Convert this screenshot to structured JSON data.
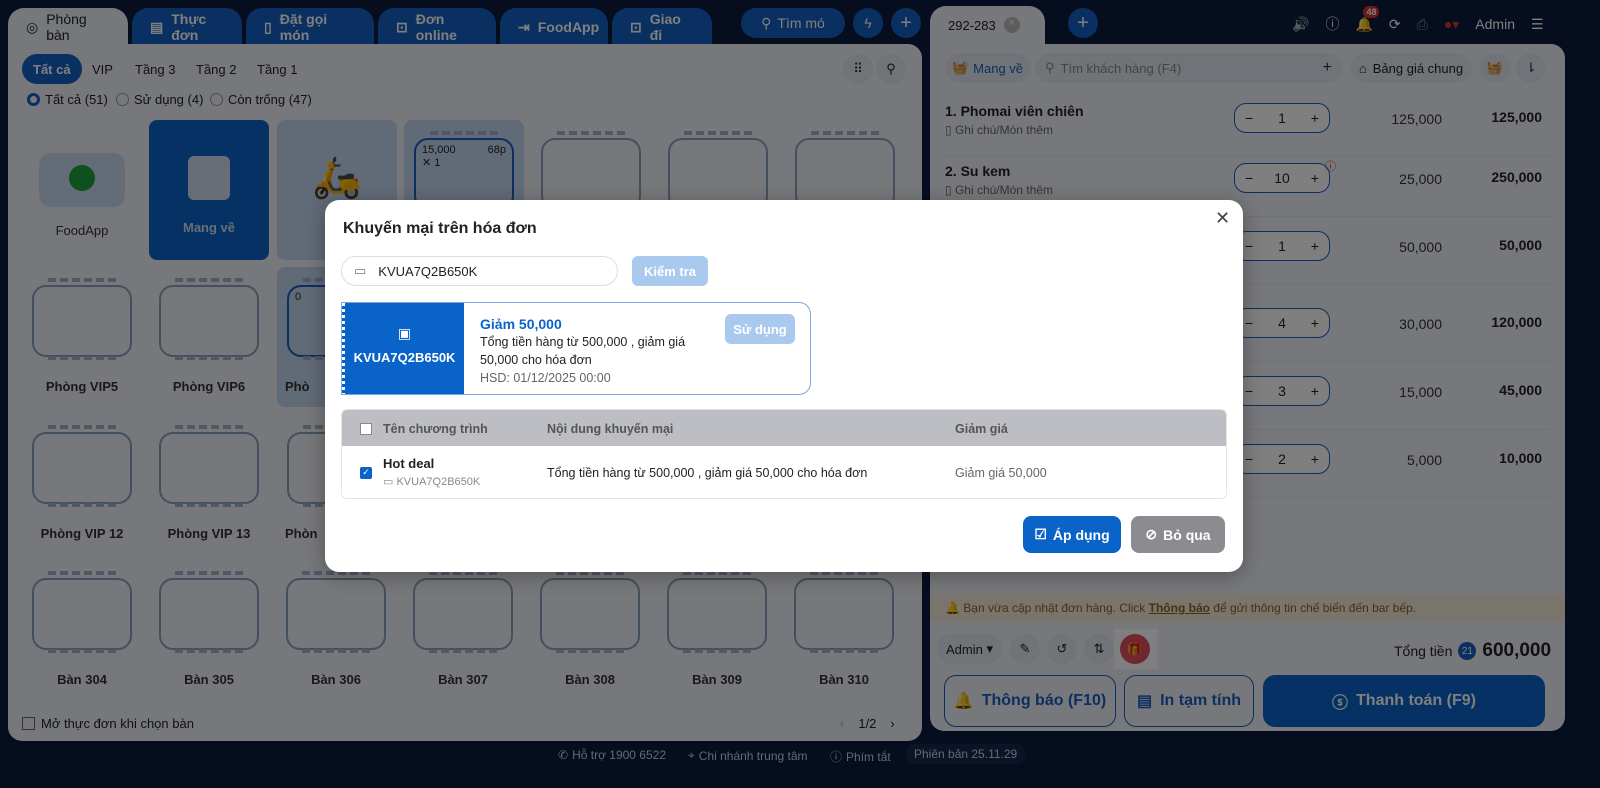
{
  "nav": {
    "tabs": [
      "Phòng bàn",
      "Thực đơn",
      "Đặt gọi món",
      "Đơn online",
      "FoodApp",
      "Giao đi"
    ],
    "search": "Tìm mó"
  },
  "left": {
    "filters": [
      "Tất cả",
      "VIP",
      "Tầng 3",
      "Tầng 2",
      "Tầng 1"
    ],
    "radios": [
      "Tất cả (51)",
      "Sử dụng (4)",
      "Còn trống (47)"
    ],
    "cards": {
      "foodapp": "FoodApp",
      "takeaway": "Mang về",
      "occ_price": "15,000",
      "occ_time": "68p",
      "occ_guests": "1",
      "vip_zero": "0"
    },
    "row2": [
      "Phòng VIP5",
      "Phòng VIP6",
      "Phò"
    ],
    "row3": [
      "Phòng VIP 12",
      "Phòng VIP 13",
      "Phòn"
    ],
    "row4": [
      "Bàn 304",
      "Bàn 305",
      "Bàn 306",
      "Bàn 307",
      "Bàn 308",
      "Bàn 309",
      "Bàn 310"
    ],
    "open_menu": "Mở thực đơn khi chọn bàn",
    "page": "1/2"
  },
  "right": {
    "order_tab": "292-283",
    "badge": "48",
    "user": "Admin",
    "mode": "Mang về",
    "customer_placeholder": "Tìm khách hàng (F4)",
    "pricebook": "Bảng giá chung",
    "items": [
      {
        "name": "1. Phomai viên chiên",
        "note": "Ghi chú/Món thêm",
        "qty": "1",
        "price": "125,000",
        "total": "125,000"
      },
      {
        "name": "2. Su kem",
        "note": "Ghi chú/Món thêm",
        "qty": "10",
        "price": "25,000",
        "total": "250,000"
      },
      {
        "qty": "1",
        "price": "50,000",
        "total": "50,000"
      },
      {
        "qty": "4",
        "price": "30,000",
        "total": "120,000"
      },
      {
        "qty": "3",
        "price": "15,000",
        "total": "45,000"
      },
      {
        "qty": "2",
        "price": "5,000",
        "total": "10,000"
      }
    ],
    "notice_pre": "Bạn vừa cập nhật đơn hàng. Click ",
    "notice_link": "Thông báo",
    "notice_post": " để gửi thông tin chế biến đến bar bếp.",
    "staff": "Admin",
    "total_label": "Tổng tiền",
    "total_count": "21",
    "total_value": "600,000",
    "btn_notify": "Thông báo (F10)",
    "btn_print": "In tạm tính",
    "btn_pay": "Thanh toán (F9)"
  },
  "footer": {
    "support": "Hỗ trợ 1900 6522",
    "branch": "Chi nhánh trung tâm",
    "shortcuts": "Phím tắt",
    "version": "Phiên bản 25.11.29"
  },
  "modal": {
    "title": "Khuyến mại trên hóa đơn",
    "code": "KVUA7Q2B650K",
    "check": "Kiểm tra",
    "voucher": {
      "code": "KVUA7Q2B650K",
      "title": "Giảm 50,000",
      "desc": "Tổng tiền hàng từ 500,000 , giảm giá 50,000 cho hóa đơn",
      "expiry": "HSD: 01/12/2025 00:00",
      "use": "Sử dụng"
    },
    "table": {
      "headers": [
        "Tên chương trình",
        "Nội dung khuyến mại",
        "Giảm giá"
      ],
      "rows": [
        {
          "name": "Hot deal",
          "code": "KVUA7Q2B650K",
          "content": "Tổng tiền hàng từ 500,000 , giảm giá 50,000 cho hóa đơn",
          "discount": "Giảm giá 50,000"
        }
      ]
    },
    "apply": "Áp dụng",
    "skip": "Bỏ qua"
  },
  "colors": {
    "primary": "#0a63c9",
    "nav": "#0a1a3f"
  }
}
